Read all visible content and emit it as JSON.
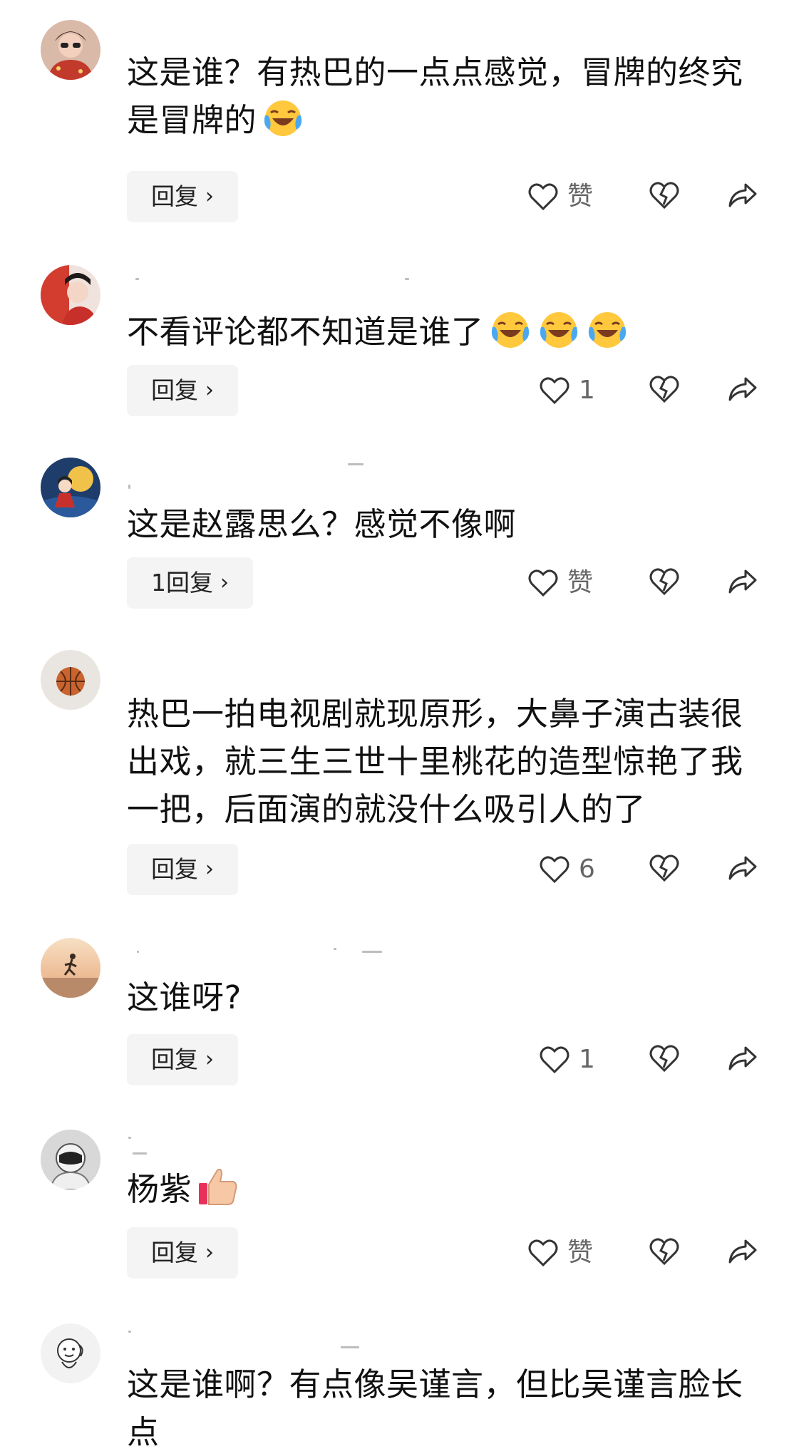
{
  "comments": [
    {
      "text": "这是谁？有热巴的一点点感觉，冒牌的终究是冒牌的",
      "emojis": [
        "laugh-cry-emoji"
      ],
      "reply_label": "回复",
      "like_label": "赞",
      "avatar": "woman-sunglasses-avatar"
    },
    {
      "text": "不看评论都不知道是谁了",
      "emojis": [
        "laugh-cry-emoji",
        "laugh-cry-emoji",
        "laugh-cry-emoji"
      ],
      "reply_label": "回复",
      "like_label": "1",
      "avatar": "red-costume-avatar"
    },
    {
      "text": "这是赵露思么？感觉不像啊",
      "emojis": [],
      "reply_label": "1回复",
      "like_label": "赞",
      "avatar": "cartoon-girl-avatar"
    },
    {
      "text": "热巴一拍电视剧就现原形，大鼻子演古装很出戏，就三生三世十里桃花的造型惊艳了我一把，后面演的就没什么吸引人的了",
      "emojis": [],
      "reply_label": "回复",
      "like_label": "6",
      "avatar": "basketball-avatar"
    },
    {
      "text": "这谁呀?",
      "emojis": [],
      "reply_label": "回复",
      "like_label": "1",
      "avatar": "sunset-runner-avatar"
    },
    {
      "text": "杨紫",
      "emojis": [
        "thumbs-up-emoji"
      ],
      "reply_label": "回复",
      "like_label": "赞",
      "avatar": "astronaut-avatar"
    },
    {
      "text": "这是谁啊？有点像吴谨言，但比吴谨言脸长点",
      "emojis": [],
      "reply_label": "",
      "like_label": "",
      "avatar": "cartoon-face-avatar"
    }
  ],
  "icons": {
    "like": "heart-outline-icon",
    "dislike": "broken-heart-icon",
    "share": "share-arrow-icon",
    "chevron": "chevron-right-icon"
  },
  "colors": {
    "reply_bg": "#f4f4f4",
    "icon": "#333333",
    "count": "#666666"
  }
}
